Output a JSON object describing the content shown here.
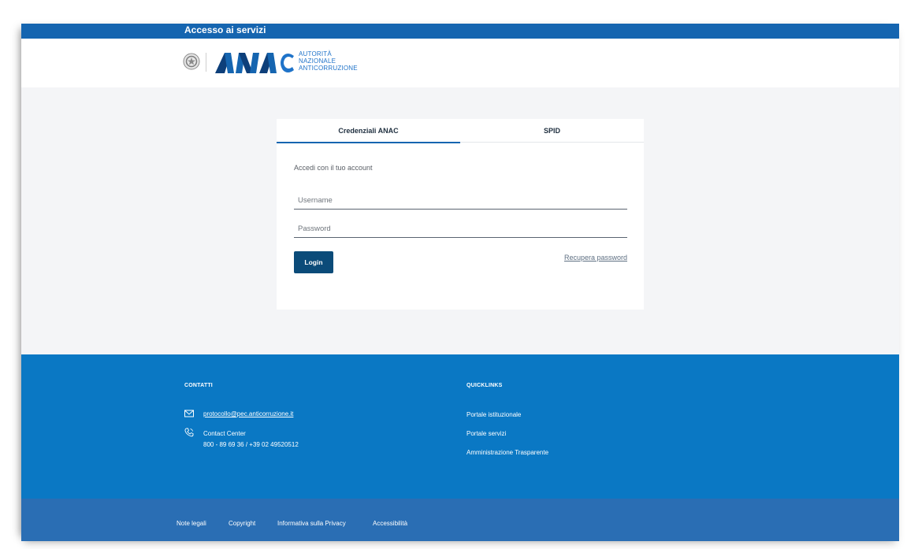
{
  "header": {
    "title": "Accesso ai servizi"
  },
  "brand": {
    "logo_name": "ANAC",
    "logo_lines": [
      "AUTORITÀ",
      "NAZIONALE",
      "ANTICORRUZIONE"
    ]
  },
  "login": {
    "tabs": [
      {
        "label": "Credenziali ANAC",
        "active": true
      },
      {
        "label": "SPID",
        "active": false
      }
    ],
    "subtitle": "Accedi con il tuo account",
    "username": {
      "placeholder": "Username",
      "value": ""
    },
    "password": {
      "placeholder": "Password",
      "value": ""
    },
    "login_label": "Login",
    "recover_label": "Recupera password"
  },
  "footer": {
    "contacts": {
      "heading": "CONTATTI",
      "email": "protocollo@pec.anticorruzione.it",
      "contact_center_label": "Contact Center",
      "phone": "800 - 89 69 36 / +39 02 49520512"
    },
    "quicklinks": {
      "heading": "QUICKLINKS",
      "items": [
        "Portale istituzionale",
        "Portale servizi",
        "Amministrazione Trasparente"
      ]
    }
  },
  "legal": {
    "items": [
      "Note legali",
      "Copyright",
      "Informativa sulla Privacy",
      "Accessibilità"
    ]
  },
  "colors": {
    "topbar": "#1565b0",
    "footer": "#0a78c4",
    "legalbar": "#2a6eb4",
    "button": "#0b4b79"
  },
  "icons": {
    "emblem": "italian-republic-emblem-icon",
    "email": "envelope-icon",
    "phone": "phone-icon"
  }
}
